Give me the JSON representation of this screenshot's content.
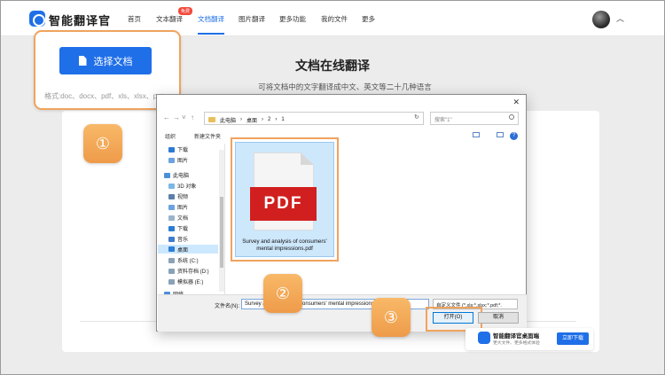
{
  "app": {
    "brand": "智能翻译官"
  },
  "nav": {
    "items": [
      "首页",
      "文本翻译",
      "文档翻译",
      "图片翻译",
      "更多功能",
      "我的文件",
      "更多"
    ],
    "badge": "免费",
    "active": "文档翻译"
  },
  "page": {
    "title": "文档在线翻译",
    "subtitle": "可将文档中的文字翻译成中文、英文等二十几种语言"
  },
  "upload": {
    "button_label": "选择文档",
    "formats": "格式:doc、docx、pdf、xls、xlsx、ppt、"
  },
  "markers": [
    "①",
    "②",
    "③"
  ],
  "dialog": {
    "breadcrumb": [
      "此电脑",
      "桌面",
      "2",
      "1"
    ],
    "search_placeholder": "搜索\"1\"",
    "toolbar": {
      "organize": "组织",
      "new_folder": "新建文件夹"
    },
    "tree": [
      "下载",
      "图片",
      "此电脑",
      "3D 对象",
      "视频",
      "图片",
      "文档",
      "下载",
      "音乐",
      "桌面",
      "系统 (C:)",
      "资料存档 (D:)",
      "模拟器 (E:)",
      "网络"
    ],
    "selected_tree_item": "桌面",
    "file_icon_label": "PDF",
    "file_name": "Survey and analysis of consumers' mental impressions.pdf",
    "filename_label": "文件名(N):",
    "filename_value": "Survey and analysis of consumers' mental impressions.pdf",
    "filetype_value": "自定义文件 (*.xls;*.xlsx;*.pdf;*.",
    "open_label": "打开(O)",
    "cancel_label": "取消"
  },
  "promo": {
    "title": "智能翻译官桌面端",
    "subtitle": "更大文件、更多格式体验",
    "button_label": "立即下载"
  },
  "colors": {
    "accent": "#1f6fe8",
    "highlight": "#f0a35e",
    "pdf_red": "#d11f1f"
  }
}
